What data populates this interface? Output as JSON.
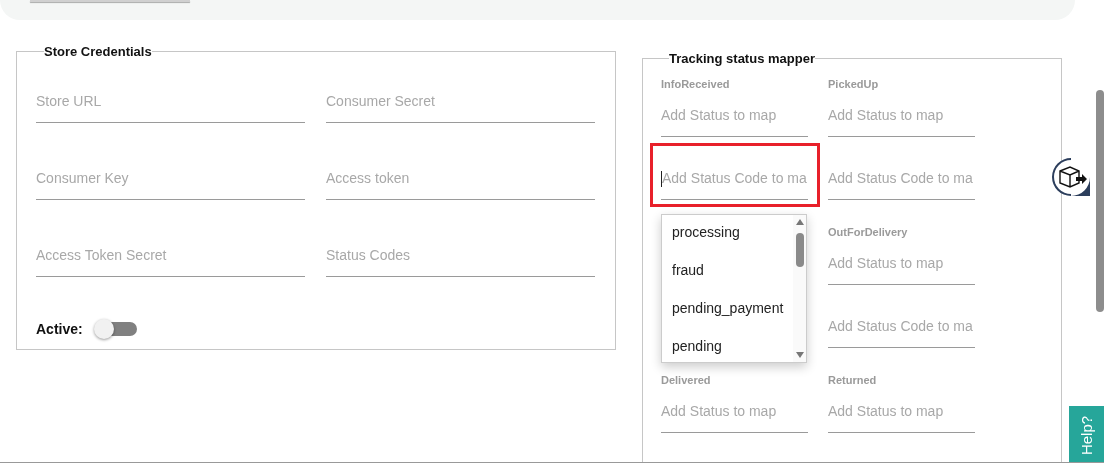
{
  "store_credentials": {
    "title": "Store Credentials",
    "fields": [
      {
        "placeholder": "Store URL"
      },
      {
        "placeholder": "Consumer Secret"
      },
      {
        "placeholder": "Consumer Key"
      },
      {
        "placeholder": "Access token"
      },
      {
        "placeholder": "Access Token Secret"
      },
      {
        "placeholder": "Status Codes"
      }
    ],
    "active": {
      "label": "Active:",
      "on": false
    }
  },
  "tracking_status_mapper": {
    "title": "Tracking status mapper",
    "rows": [
      {
        "left": {
          "label": "InfoReceived",
          "status_placeholder": "Add Status to map",
          "code_placeholder": "Add Status Code to ma",
          "highlighted": true,
          "dropdown": {
            "options": [
              "processing",
              "fraud",
              "pending_payment",
              "pending"
            ]
          }
        },
        "right": {
          "label": "PickedUp",
          "status_placeholder": "Add Status to map",
          "code_placeholder": "Add Status Code to ma",
          "highlighted": false
        }
      },
      {
        "right": {
          "label": "OutForDelivery",
          "status_placeholder": "Add Status to map",
          "code_placeholder": "Add Status Code to ma",
          "highlighted": false
        }
      },
      {
        "left": {
          "label": "Delivered",
          "status_placeholder": "Add Status to map"
        },
        "right": {
          "label": "Returned",
          "status_placeholder": "Add Status to map"
        }
      }
    ]
  },
  "help_tab": {
    "label": "Help?"
  }
}
